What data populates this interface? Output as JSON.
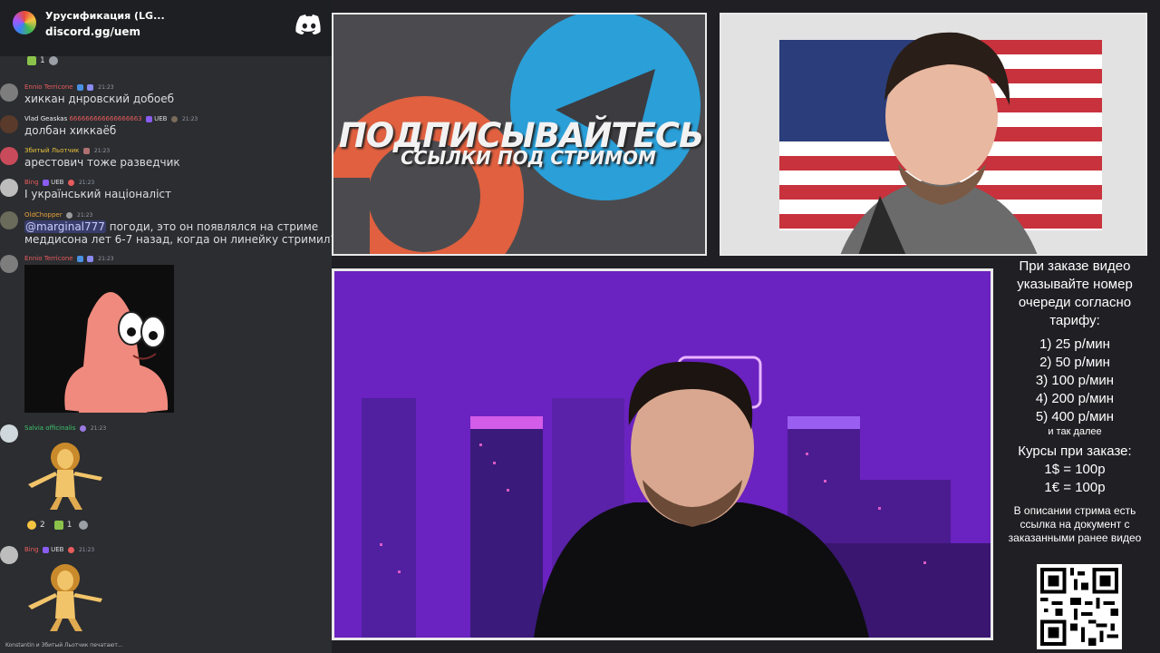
{
  "server": {
    "name": "Урусификация (LG...",
    "link": "discord.gg/uem"
  },
  "chat": {
    "top_reaction_count": "1",
    "messages": [
      {
        "user": "Ennio Terricone",
        "user_color": "#e85c5c",
        "time": "21:23",
        "text": "хиккан днровский добоеб"
      },
      {
        "user": "Vlad Geaskas",
        "user_color": "#f0f0f0",
        "extra": "666666666666666663",
        "badge": "UEB",
        "time": "21:23",
        "text": "долбан хиккаёб"
      },
      {
        "user": "Збитый Льотчик",
        "user_color": "#e8c23a",
        "time": "21:23",
        "text": "арестович тоже разведчик"
      },
      {
        "user": "Bing",
        "user_color": "#e85c5c",
        "badge": "UEB",
        "time": "21:23",
        "text": "І український націоналіст"
      },
      {
        "user": "OldChopper",
        "user_color": "#e8a23a",
        "time": "21:23",
        "mention": "@marginal777",
        "text": " погоди, это он появлялся на стриме",
        "text2": "меддисона лет 6-7 назад, когда он линейку стримил?"
      },
      {
        "user": "Ennio Terricone",
        "user_color": "#e85c5c",
        "time": "21:23"
      },
      {
        "user": "Salvia officinalis",
        "user_color": "#3fc46b",
        "time": "21:23"
      },
      {
        "user": "Bing",
        "user_color": "#e85c5c",
        "badge": "UEB",
        "time": "21:23"
      }
    ],
    "reactions_after_salvia": [
      "2",
      "1"
    ],
    "typing": "Konstantin и Збитый Льотчик печатают..."
  },
  "banner": {
    "title": "ПОДПИСЫВАЙТЕСЬ",
    "subtitle": "ССЫЛКИ ПОД СТРИМОМ"
  },
  "info": {
    "order_note": "При заказе видео указывайте номер очереди согласно тарифу:",
    "tariffs": [
      "1) 25 р/мин",
      "2) 50 р/мин",
      "3) 100 р/мин",
      "4) 200 р/мин",
      "5) 400 р/мин"
    ],
    "and_so_on": "и так далее",
    "rates_title": "Курсы при заказе:",
    "rates": [
      "1$ = 100р",
      "1€ = 100р"
    ],
    "description_note": "В описании стрима есть ссылка на документ с заказанными ранее видео"
  },
  "colors": {
    "chat_bg": "#2b2d31",
    "server_bar_bg": "#1e1f22",
    "patreon": "#e0603f",
    "telegram": "#2a9fd8",
    "scene_purple": "#7a25c4"
  }
}
